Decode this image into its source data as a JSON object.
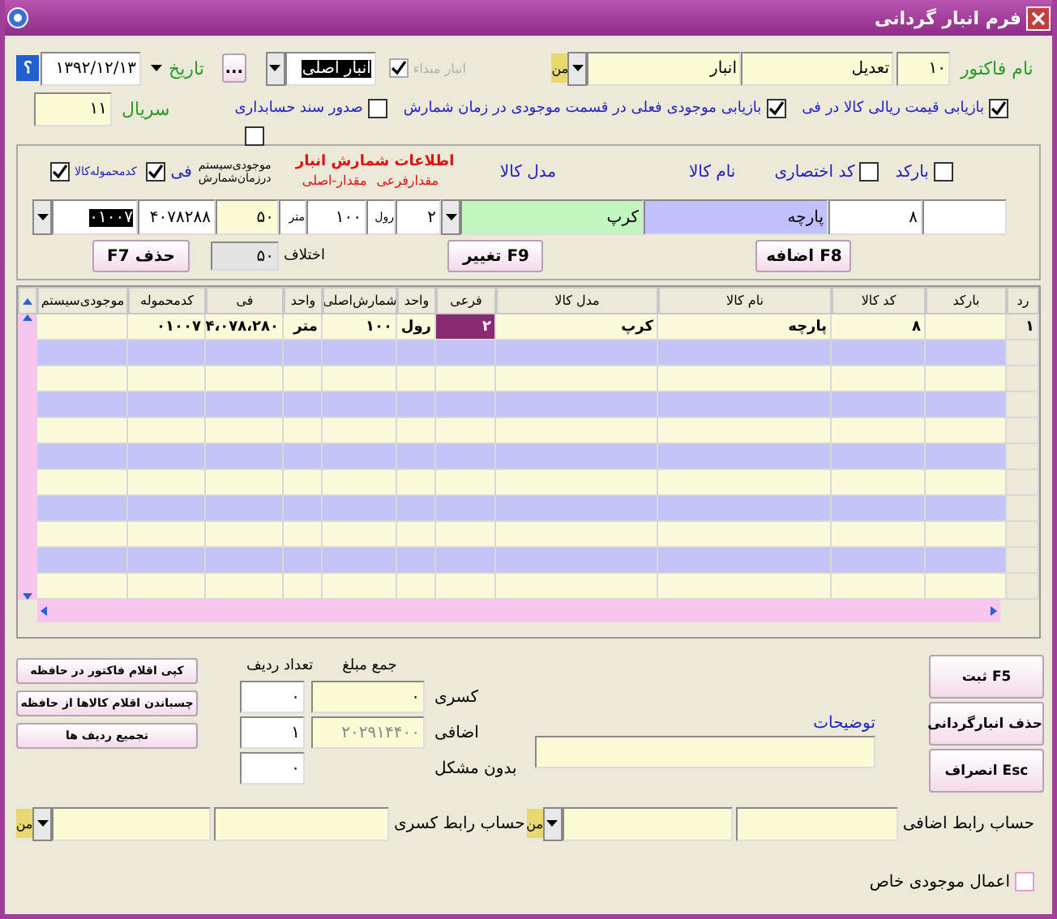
{
  "window": {
    "title": "فرم انبار گردانی"
  },
  "header": {
    "help": "؟",
    "date": "۱۳۹۲/۱۲/۱۳",
    "date_label": "تاریخ",
    "more": "...",
    "main_warehouse": "انبار اصلی",
    "source_warehouse": {
      "label": "انبار مبداء",
      "checked": true,
      "disabled": true
    },
    "currency": "من",
    "warehouse": "انبار",
    "invoice_type": "تعدیل",
    "invoice_no": "۱۰",
    "invoice_name_label": "نام فاکتور",
    "serial_label": "سریال",
    "serial": "۱۱"
  },
  "options": [
    {
      "label": "بازیابی قیمت ریالی کالا در فی",
      "checked": true
    },
    {
      "label": "بازیابی موجودی فعلی در قسمت موجودی در زمان شمارش",
      "checked": true
    },
    {
      "label": "صدور سند حسابداری",
      "checked": false
    }
  ],
  "extra_checkbox": {
    "checked": false
  },
  "entry": {
    "barcode": {
      "label": "بارکد",
      "checked": false
    },
    "short_code": {
      "label": "کد اختصاری",
      "checked": false
    },
    "name_label": "نام کالا",
    "model_label": "مدل کالا",
    "count_title": "اطلاعات شمارش انبار",
    "sub_qty_label": "مقدارفرعی",
    "main_qty_label": "مقدار-اصلی",
    "stock_label_1": "موجودی‌سیستم",
    "stock_label_2": "درزمان‌شمارش",
    "price": {
      "label": "فی",
      "checked": true
    },
    "lot": {
      "label": "کدمحموله‌کالا",
      "checked": true
    },
    "code": "۸",
    "name": "پارچه",
    "model": "کرپ",
    "sub_qty": "۲",
    "sub_unit": "رول",
    "main_qty": "۱۰۰",
    "main_unit": "متر",
    "stock": "۵۰",
    "price_value": "۴۰۷۸۲۸۸",
    "lot_value": "۰۱۰۰۷",
    "diff_label": "اختلاف",
    "diff": "۵۰",
    "buttons": [
      "F8 اضافه",
      "F9 تغییر",
      "حذف F7"
    ]
  },
  "table": {
    "columns": [
      "رد",
      "بارکد",
      "کد کالا",
      "نام کالا",
      "مدل کالا",
      "فرعی",
      "واحد",
      "شمارش‌اصلی",
      "واحد",
      "فی",
      "کدمحموله",
      "موجودی‌سیستم"
    ],
    "rows": [
      {
        "cells": [
          {
            "text": "۱",
            "selected": false
          },
          {
            "selected": false
          },
          {
            "text": "۸",
            "selected": false
          },
          {
            "text": "پارچه",
            "selected": false
          },
          {
            "text": "کرپ",
            "selected": false
          },
          {
            "text": "۲",
            "selected": true
          },
          {
            "text": "رول",
            "selected": false
          },
          {
            "text": "۱۰۰",
            "selected": false
          },
          {
            "text": "متر",
            "selected": false
          },
          {
            "text": "۴،۰۷۸،۲۸۰",
            "selected": false
          },
          {
            "text": "۰۱۰۰۷",
            "selected": false
          },
          {
            "selected": false
          }
        ]
      }
    ]
  },
  "memory_buttons": [
    "کپی اقلام فاکتور در حافظه",
    "چسباندن اقلام کالاها از حافظه",
    "تجمیع ردیف ها"
  ],
  "totals": {
    "count_label": "تعداد ردیف",
    "amount_label": "جمع مبلغ",
    "rows": [
      {
        "label": "کسری",
        "count": "۰",
        "amount": "۰"
      },
      {
        "label": "اضافی",
        "count": "۱",
        "amount": "۲۰۲۹۱۴۴۰۰"
      },
      {
        "label": "بدون مشکل",
        "count": "۰"
      }
    ]
  },
  "description_label": "توضیحات",
  "actions": [
    "F5 ثبت",
    "حذف انبارگردانی",
    "Esc انصراف"
  ],
  "accounts": [
    {
      "label": "حساب رابط اضافی",
      "currency": "من"
    },
    {
      "label": "حساب رابط کسری",
      "currency": "من"
    }
  ],
  "special_stock": {
    "label": "اعمال موجودی خاص",
    "checked": false
  }
}
